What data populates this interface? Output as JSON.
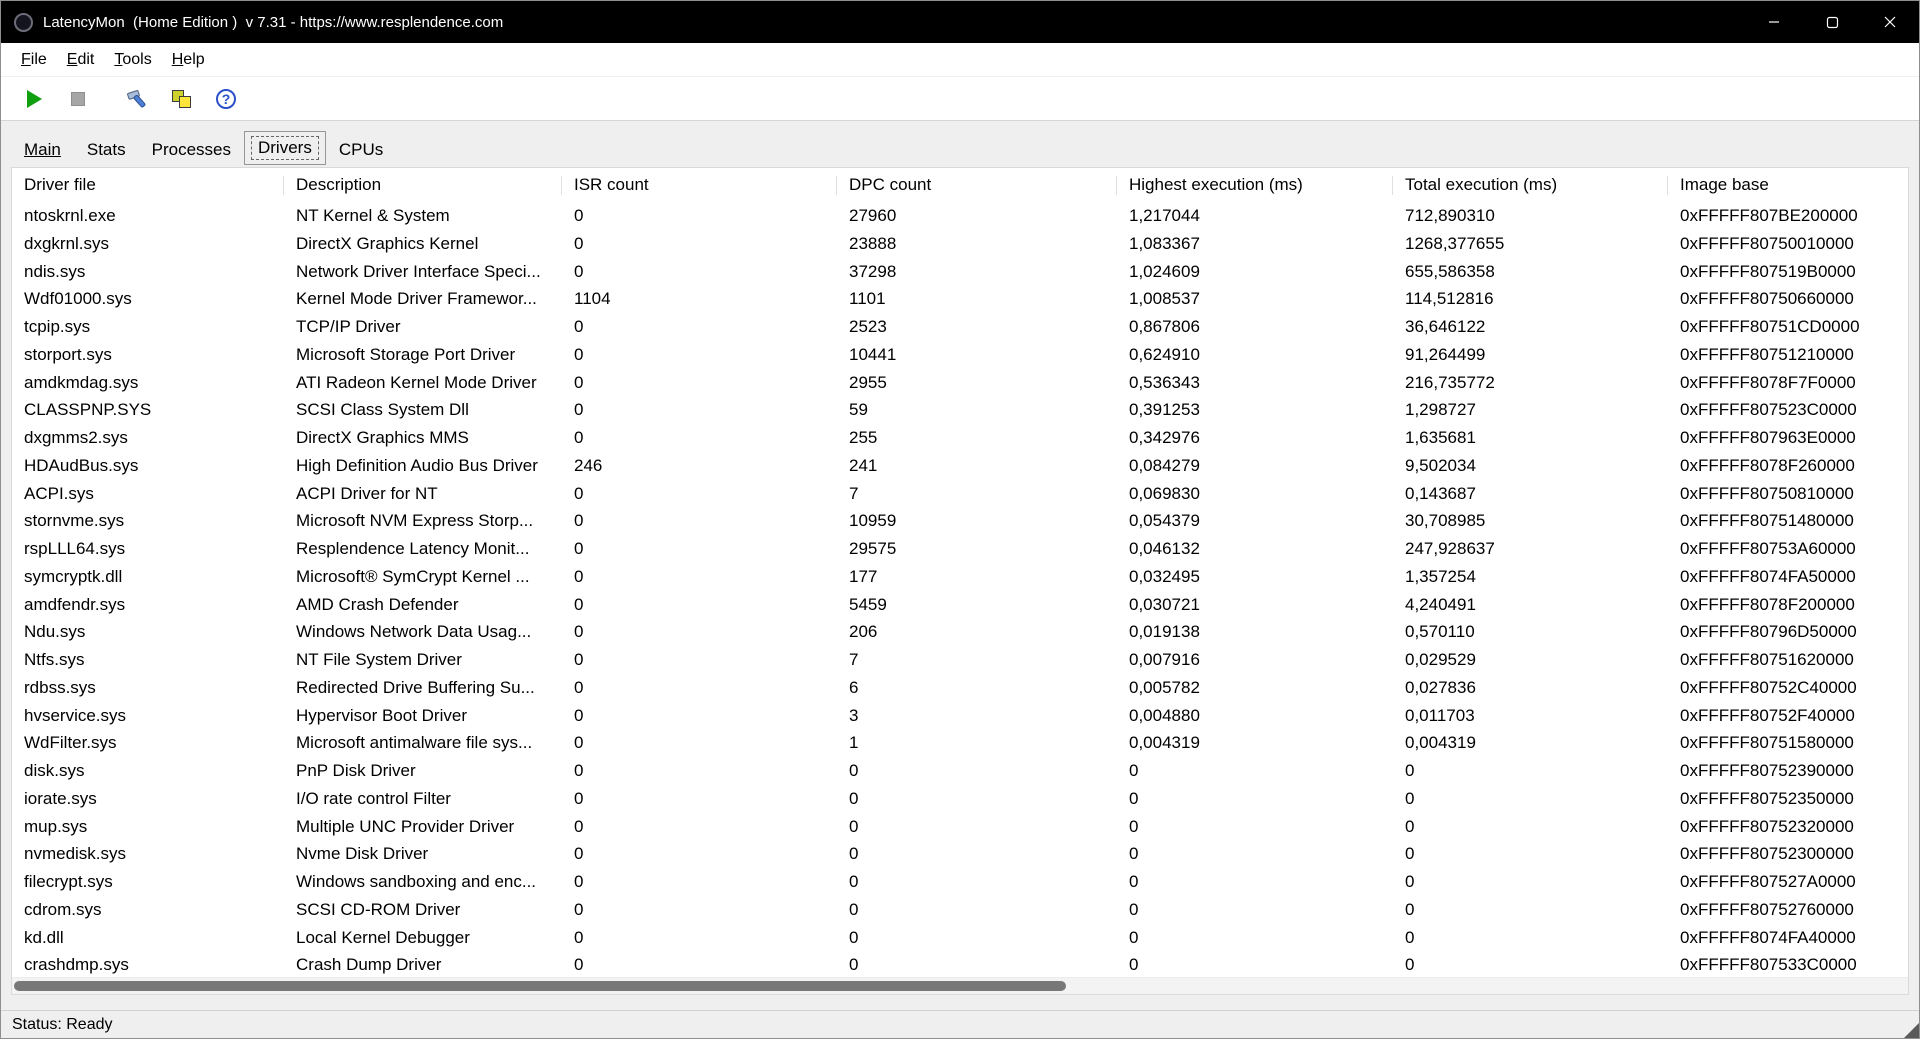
{
  "window": {
    "title": "LatencyMon  (Home Edition )  v 7.31 - https://www.resplendence.com",
    "control_icons": [
      "minimize-icon",
      "maximize-icon",
      "close-icon"
    ]
  },
  "menu": {
    "items": [
      {
        "label": "File"
      },
      {
        "label": "Edit"
      },
      {
        "label": "Tools"
      },
      {
        "label": "Help"
      }
    ]
  },
  "toolbar": {
    "icons": [
      "play-icon",
      "stop-icon",
      "tools-icon",
      "copy-icon",
      "help-icon"
    ],
    "help_glyph": "?"
  },
  "tabs": [
    {
      "label": "Main",
      "active": false,
      "underlined": true
    },
    {
      "label": "Stats",
      "active": false
    },
    {
      "label": "Processes",
      "active": false
    },
    {
      "label": "Drivers",
      "active": true
    },
    {
      "label": "CPUs",
      "active": false
    }
  ],
  "table": {
    "columns": [
      "Driver file",
      "Description",
      "ISR count",
      "DPC count",
      "Highest execution (ms)",
      "Total execution (ms)",
      "Image base"
    ],
    "rows": [
      [
        "ntoskrnl.exe",
        "NT Kernel & System",
        "0",
        "27960",
        "1,217044",
        "712,890310",
        "0xFFFFF807BE200000"
      ],
      [
        "dxgkrnl.sys",
        "DirectX Graphics Kernel",
        "0",
        "23888",
        "1,083367",
        "1268,377655",
        "0xFFFFF80750010000"
      ],
      [
        "ndis.sys",
        "Network Driver Interface Speci...",
        "0",
        "37298",
        "1,024609",
        "655,586358",
        "0xFFFFF807519B0000"
      ],
      [
        "Wdf01000.sys",
        "Kernel Mode Driver Framewor...",
        "1104",
        "1101",
        "1,008537",
        "114,512816",
        "0xFFFFF80750660000"
      ],
      [
        "tcpip.sys",
        "TCP/IP Driver",
        "0",
        "2523",
        "0,867806",
        "36,646122",
        "0xFFFFF80751CD0000"
      ],
      [
        "storport.sys",
        "Microsoft Storage Port Driver",
        "0",
        "10441",
        "0,624910",
        "91,264499",
        "0xFFFFF80751210000"
      ],
      [
        "amdkmdag.sys",
        "ATI Radeon Kernel Mode Driver",
        "0",
        "2955",
        "0,536343",
        "216,735772",
        "0xFFFFF8078F7F0000"
      ],
      [
        "CLASSPNP.SYS",
        "SCSI Class System Dll",
        "0",
        "59",
        "0,391253",
        "1,298727",
        "0xFFFFF807523C0000"
      ],
      [
        "dxgmms2.sys",
        "DirectX Graphics MMS",
        "0",
        "255",
        "0,342976",
        "1,635681",
        "0xFFFFF807963E0000"
      ],
      [
        "HDAudBus.sys",
        "High Definition Audio Bus Driver",
        "246",
        "241",
        "0,084279",
        "9,502034",
        "0xFFFFF8078F260000"
      ],
      [
        "ACPI.sys",
        "ACPI Driver for NT",
        "0",
        "7",
        "0,069830",
        "0,143687",
        "0xFFFFF80750810000"
      ],
      [
        "stornvme.sys",
        "Microsoft NVM Express Storp...",
        "0",
        "10959",
        "0,054379",
        "30,708985",
        "0xFFFFF80751480000"
      ],
      [
        "rspLLL64.sys",
        "Resplendence Latency Monit...",
        "0",
        "29575",
        "0,046132",
        "247,928637",
        "0xFFFFF80753A60000"
      ],
      [
        "symcryptk.dll",
        "Microsoft® SymCrypt Kernel ...",
        "0",
        "177",
        "0,032495",
        "1,357254",
        "0xFFFFF8074FA50000"
      ],
      [
        "amdfendr.sys",
        "AMD Crash Defender",
        "0",
        "5459",
        "0,030721",
        "4,240491",
        "0xFFFFF8078F200000"
      ],
      [
        "Ndu.sys",
        "Windows Network Data Usag...",
        "0",
        "206",
        "0,019138",
        "0,570110",
        "0xFFFFF80796D50000"
      ],
      [
        "Ntfs.sys",
        "NT File System Driver",
        "0",
        "7",
        "0,007916",
        "0,029529",
        "0xFFFFF80751620000"
      ],
      [
        "rdbss.sys",
        "Redirected Drive Buffering Su...",
        "0",
        "6",
        "0,005782",
        "0,027836",
        "0xFFFFF80752C40000"
      ],
      [
        "hvservice.sys",
        "Hypervisor Boot Driver",
        "0",
        "3",
        "0,004880",
        "0,011703",
        "0xFFFFF80752F40000"
      ],
      [
        "WdFilter.sys",
        "Microsoft antimalware file sys...",
        "0",
        "1",
        "0,004319",
        "0,004319",
        "0xFFFFF80751580000"
      ],
      [
        "disk.sys",
        "PnP Disk Driver",
        "0",
        "0",
        "0",
        "0",
        "0xFFFFF80752390000"
      ],
      [
        "iorate.sys",
        "I/O rate control Filter",
        "0",
        "0",
        "0",
        "0",
        "0xFFFFF80752350000"
      ],
      [
        "mup.sys",
        "Multiple UNC Provider Driver",
        "0",
        "0",
        "0",
        "0",
        "0xFFFFF80752320000"
      ],
      [
        "nvmedisk.sys",
        "Nvme Disk Driver",
        "0",
        "0",
        "0",
        "0",
        "0xFFFFF80752300000"
      ],
      [
        "filecrypt.sys",
        "Windows sandboxing and enc...",
        "0",
        "0",
        "0",
        "0",
        "0xFFFFF807527A0000"
      ],
      [
        "cdrom.sys",
        "SCSI CD-ROM Driver",
        "0",
        "0",
        "0",
        "0",
        "0xFFFFF80752760000"
      ],
      [
        "kd.dll",
        "Local Kernel Debugger",
        "0",
        "0",
        "0",
        "0",
        "0xFFFFF8074FA40000"
      ],
      [
        "crashdmp.sys",
        "Crash Dump Driver",
        "0",
        "0",
        "0",
        "0",
        "0xFFFFF807533C0000"
      ]
    ]
  },
  "status": {
    "text": "Status: Ready"
  },
  "colors": {
    "titlebar_bg": "#000000",
    "play_green": "#0f9f0f",
    "stop_gray": "#a6a6a6",
    "help_blue": "#2b50c8",
    "copy_yellow": "#ffe53a",
    "scrollbar_thumb": "#787878",
    "content_bg": "#efefef"
  }
}
